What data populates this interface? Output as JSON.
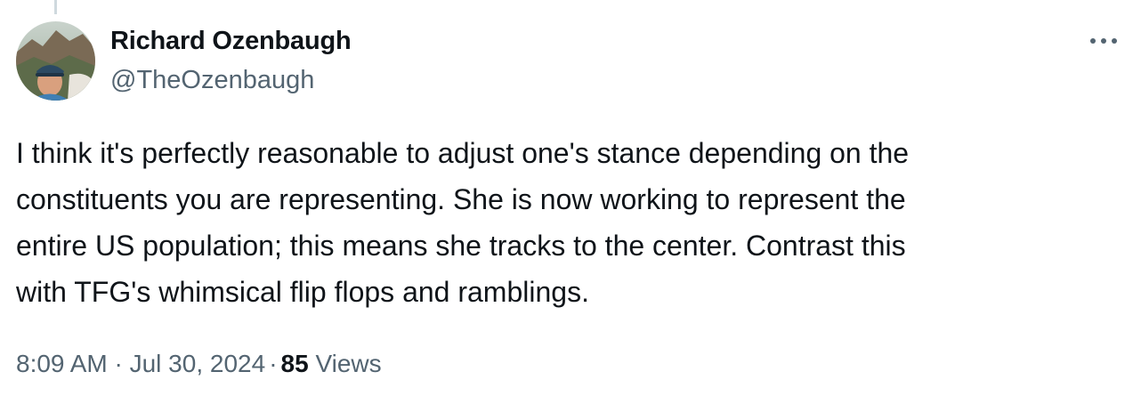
{
  "tweet": {
    "author": {
      "display_name": "Richard Ozenbaugh",
      "handle": "@TheOzenbaugh"
    },
    "text": "I think it's perfectly reasonable to adjust one's stance depending on the\nconstituents you are representing.  She is now working to represent the\nentire US population; this means she tracks to the center. Contrast this\nwith TFG's whimsical flip flops and ramblings.",
    "timestamp": "8:09 AM · Jul 30, 2024",
    "separator": "·",
    "views_count": "85",
    "views_label": "Views",
    "more_icon": "more-horizontal-icon"
  },
  "colors": {
    "primary_text": "#0f1419",
    "secondary_text": "#536471",
    "thread_line": "#cfd9de"
  }
}
